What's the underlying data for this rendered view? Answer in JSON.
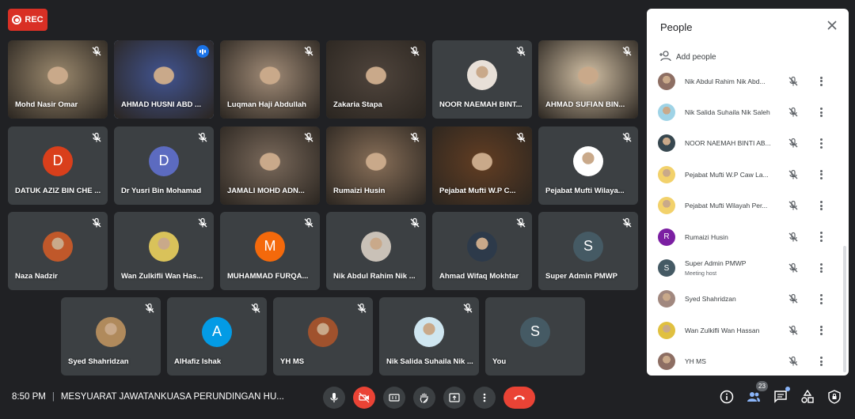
{
  "rec_label": "REC",
  "tiles": [
    {
      "name": "Mohd Nasir Omar",
      "kind": "video",
      "bg": "#8a7a62",
      "muted": true
    },
    {
      "name": "AHMAD HUSNI ABD ...",
      "kind": "video",
      "bg": "#3e4d80",
      "muted": false,
      "speaking": true
    },
    {
      "name": "Luqman Haji Abdullah",
      "kind": "video",
      "bg": "#8f7c6a",
      "muted": true
    },
    {
      "name": "Zakaria Stapa",
      "kind": "video",
      "bg": "#4a4038",
      "muted": true
    },
    {
      "name": "NOOR NAEMAH BINT...",
      "kind": "photo",
      "bg": "#e8e0d8",
      "muted": true
    },
    {
      "name": "AHMAD SUFIAN BIN...",
      "kind": "video",
      "bg": "#b9a991",
      "muted": true
    },
    {
      "name": "DATUK AZIZ BIN CHE ...",
      "kind": "letter",
      "letter": "D",
      "color": "#d93f1b",
      "muted": true
    },
    {
      "name": "Dr Yusri Bin Mohamad",
      "kind": "letter",
      "letter": "D",
      "color": "#5c6bc0",
      "muted": true
    },
    {
      "name": "JAMALI MOHD ADN...",
      "kind": "video",
      "bg": "#6e5f52",
      "muted": true
    },
    {
      "name": "Rumaizi Husin",
      "kind": "video",
      "bg": "#7a6450",
      "muted": true
    },
    {
      "name": "Pejabat Mufti W.P C...",
      "kind": "video",
      "bg": "#5a3a22",
      "muted": true
    },
    {
      "name": "Pejabat Mufti Wilaya...",
      "kind": "photo",
      "bg": "#ffffff",
      "muted": true
    },
    {
      "name": "Naza Nadzir",
      "kind": "photo",
      "bg": "#c0582a",
      "muted": true
    },
    {
      "name": "Wan Zulkifli Wan Has...",
      "kind": "photo",
      "bg": "#d9c25a",
      "muted": true
    },
    {
      "name": "MUHAMMAD FURQA...",
      "kind": "letter",
      "letter": "M",
      "color": "#f4690b",
      "muted": true
    },
    {
      "name": "Nik Abdul Rahim Nik ...",
      "kind": "photo",
      "bg": "#c9c1b7",
      "muted": true
    },
    {
      "name": "Ahmad Wifaq Mokhtar",
      "kind": "photo",
      "bg": "#2d3a4a",
      "muted": true
    },
    {
      "name": "Super Admin PMWP",
      "kind": "letter",
      "letter": "S",
      "color": "#455a64",
      "muted": true
    },
    {
      "name": "Syed Shahridzan",
      "kind": "photo",
      "bg": "#b08a5c",
      "muted": true
    },
    {
      "name": "AlHafiz Ishak",
      "kind": "letter",
      "letter": "A",
      "color": "#039be5",
      "muted": true
    },
    {
      "name": "YH MS",
      "kind": "photo",
      "bg": "#a0522d",
      "muted": true
    },
    {
      "name": "Nik Salida Suhaila Nik ...",
      "kind": "photo",
      "bg": "#cfe6f0",
      "muted": true
    },
    {
      "name": "You",
      "kind": "letter",
      "letter": "S",
      "color": "#455a64",
      "muted": false
    }
  ],
  "people_panel": {
    "title": "People",
    "add_people": "Add people",
    "participants": [
      {
        "name": "Nik Abdul Rahim Nik Abd...",
        "kind": "photo",
        "bg": "#8d6e63"
      },
      {
        "name": "Nik Salida Suhaila Nik Saleh",
        "kind": "photo",
        "bg": "#9fd3e6"
      },
      {
        "name": "NOOR NAEMAH BINTI AB...",
        "kind": "photo",
        "bg": "#37474f"
      },
      {
        "name": "Pejabat Mufti W.P Caw La...",
        "kind": "photo",
        "bg": "#f2d16b"
      },
      {
        "name": "Pejabat Mufti Wilayah Per...",
        "kind": "photo",
        "bg": "#f2d16b"
      },
      {
        "name": "Rumaizi Husin",
        "kind": "letter",
        "letter": "R",
        "color": "#7b1fa2"
      },
      {
        "name": "Super Admin PMWP",
        "sub": "Meeting host",
        "kind": "letter",
        "letter": "S",
        "color": "#455a64"
      },
      {
        "name": "Syed Shahridzan",
        "kind": "photo",
        "bg": "#a1887f"
      },
      {
        "name": "Wan Zulkifli Wan Hassan",
        "kind": "photo",
        "bg": "#e0c040"
      },
      {
        "name": "YH MS",
        "kind": "photo",
        "bg": "#8d6e63"
      }
    ]
  },
  "bottom": {
    "time": "8:50 PM",
    "separator": "|",
    "meeting_title": "MESYUARAT JAWATANKUASA PERUNDINGAN HU...",
    "participant_count": "23"
  },
  "icons": {
    "mute": "mic-off-icon",
    "close": "close-icon",
    "add_person": "person-add-icon",
    "more": "more-vert-icon"
  },
  "colors": {
    "background": "#202124",
    "tile": "#3c4043",
    "danger": "#ea4335",
    "accent": "#8ab4f8"
  }
}
